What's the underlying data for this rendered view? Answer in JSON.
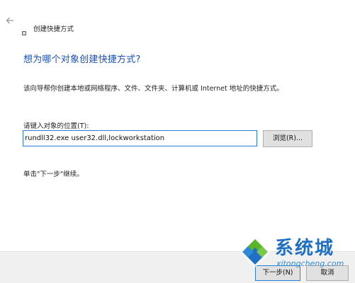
{
  "window": {
    "title": "创建快捷方式",
    "back_icon": "back-arrow-icon",
    "app_icon": "shortcut-icon"
  },
  "main": {
    "heading": "想为哪个对象创建快捷方式?",
    "description": "该向导帮你创建本地或网络程序、文件、文件夹、计算机或 Internet 地址的快捷方式。",
    "field_label": "请键入对象的位置(T):",
    "location_value": "rundll32.exe user32.dll,lockworkstation",
    "browse_label": "浏览(R)...",
    "hint": "单击\"下一步\"继续。"
  },
  "footer": {
    "next_label": "下一步(N)",
    "cancel_label": "取消"
  },
  "watermark": {
    "text": "系统城",
    "url": "xitongcheng.com"
  },
  "colors": {
    "heading": "#1a50b5",
    "focus_border": "#2d7fd6",
    "button_bg": "#e1e1e1",
    "footer_bg": "#f0f0f0",
    "watermark_blue": "#1f6fc5",
    "watermark_green": "#5ab52c"
  }
}
